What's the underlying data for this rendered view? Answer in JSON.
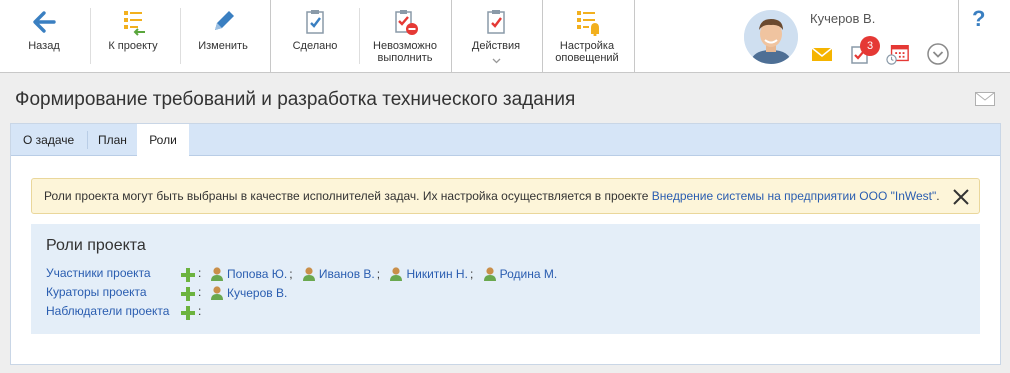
{
  "toolbar": {
    "back": "Назад",
    "to_project": "К проекту",
    "edit": "Изменить",
    "done": "Сделано",
    "impossible_l1": "Невозможно",
    "impossible_l2": "выполнить",
    "actions": "Действия",
    "notify_l1": "Настройка",
    "notify_l2": "оповещений"
  },
  "user": {
    "name": "Кучеров В.",
    "task_badge": "3"
  },
  "help": "?",
  "page": {
    "title": "Формирование требований и разработка технического задания"
  },
  "tabs": [
    "О задаче",
    "План",
    "Роли"
  ],
  "notice": {
    "text": "Роли проекта могут быть выбраны в качестве исполнителей задач. Их настройка осуществляется в проекте ",
    "link": "Внедрение системы на предприятии ООО \"InWest\"",
    "tail": "."
  },
  "roles": {
    "title": "Роли проекта",
    "rows": [
      {
        "label": "Участники проекта",
        "people": [
          "Попова Ю.",
          "Иванов В.",
          "Никитин Н.",
          "Родина М."
        ]
      },
      {
        "label": "Кураторы проекта",
        "people": [
          "Кучеров В."
        ]
      },
      {
        "label": "Наблюдатели проекта",
        "people": []
      }
    ]
  },
  "colors": {
    "accent": "#3a7fc1",
    "link": "#2a5db0",
    "notice_bg": "#fdf5d9",
    "roles_bg": "#e4eef8",
    "badge": "#e53935",
    "add_green": "#6cb33f"
  }
}
